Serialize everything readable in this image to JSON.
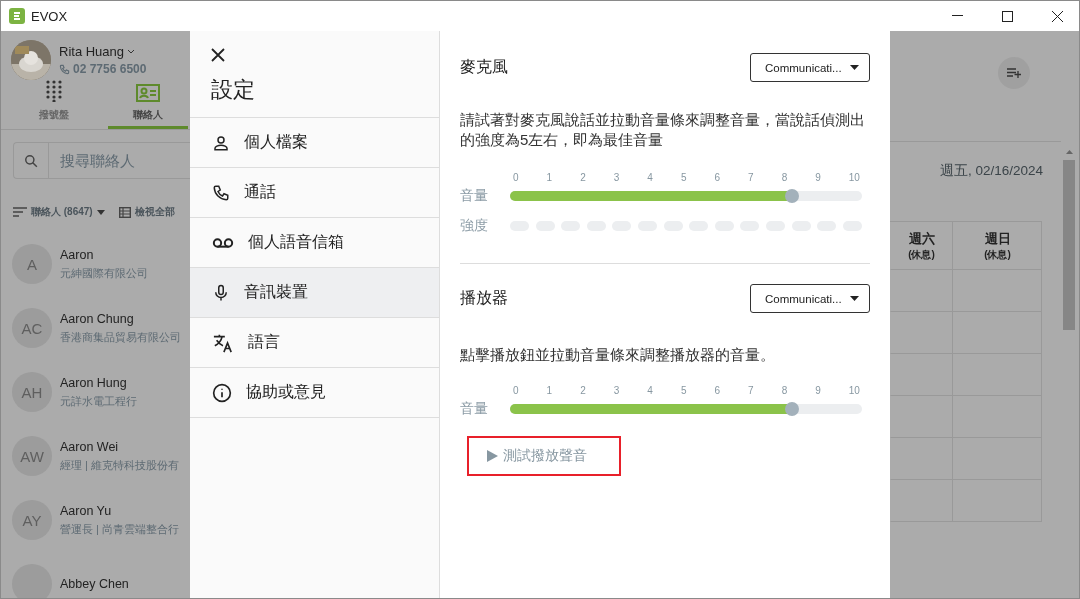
{
  "window": {
    "title": "EVOX"
  },
  "user": {
    "name": "Rita Huang",
    "phone": "02 7756 6500"
  },
  "nav_tabs": [
    {
      "label": "撥號盤",
      "selected": false
    },
    {
      "label": "聯絡人",
      "selected": true
    }
  ],
  "search": {
    "placeholder": "搜尋聯絡人"
  },
  "contacts_toolbar": {
    "filter": "聯絡人 (8647)",
    "view_all": "檢視全部"
  },
  "contacts": [
    {
      "initials": "A",
      "name": "Aaron",
      "subtitle": "元紳國際有限公司"
    },
    {
      "initials": "AC",
      "name": "Aaron Chung",
      "subtitle": "香港商集品貿易有限公司"
    },
    {
      "initials": "AH",
      "name": "Aaron Hung",
      "subtitle": "元詳水電工程行"
    },
    {
      "initials": "AW",
      "name": "Aaron Wei",
      "subtitle": "經理 | 維克特科技股份有"
    },
    {
      "initials": "AY",
      "name": "Aaron Yu",
      "subtitle": "營運長 | 尚青雲端整合行"
    },
    {
      "name": "Abbey Chen"
    }
  ],
  "calendar": {
    "date": "週五, 02/16/2024",
    "columns": [
      {
        "day": "週六",
        "note": "(休息)"
      },
      {
        "day": "週日",
        "note": "(休息)"
      }
    ]
  },
  "settings": {
    "title": "設定",
    "menu": [
      {
        "label": "個人檔案",
        "selected": false
      },
      {
        "label": "通話",
        "selected": false
      },
      {
        "label": "個人語音信箱",
        "selected": false
      },
      {
        "label": "音訊裝置",
        "selected": true
      },
      {
        "label": "語言",
        "selected": false
      },
      {
        "label": "協助或意見",
        "selected": false
      }
    ],
    "sections": [
      {
        "title": "麥克風",
        "device": "Communicati...",
        "description": "請試著對麥克風說話並拉動音量條來調整音量，當說話偵測出的強度為5左右，即為最佳音量",
        "volume_label": "音量",
        "ticks": [
          "0",
          "1",
          "2",
          "3",
          "4",
          "5",
          "6",
          "7",
          "8",
          "9",
          "10"
        ],
        "volume": {
          "level": 0.8
        },
        "meter": {
          "label": "強度"
        }
      },
      {
        "title": "播放器",
        "device": "Communicati...",
        "description": "點擊播放鈕並拉動音量條來調整播放器的音量。",
        "volume_label": "音量",
        "ticks": [
          "0",
          "1",
          "2",
          "3",
          "4",
          "5",
          "6",
          "7",
          "8",
          "9",
          "10"
        ],
        "volume": {
          "level": 0.8
        },
        "test_button": {
          "label": "測試撥放聲音",
          "highlighted": true
        }
      }
    ]
  }
}
